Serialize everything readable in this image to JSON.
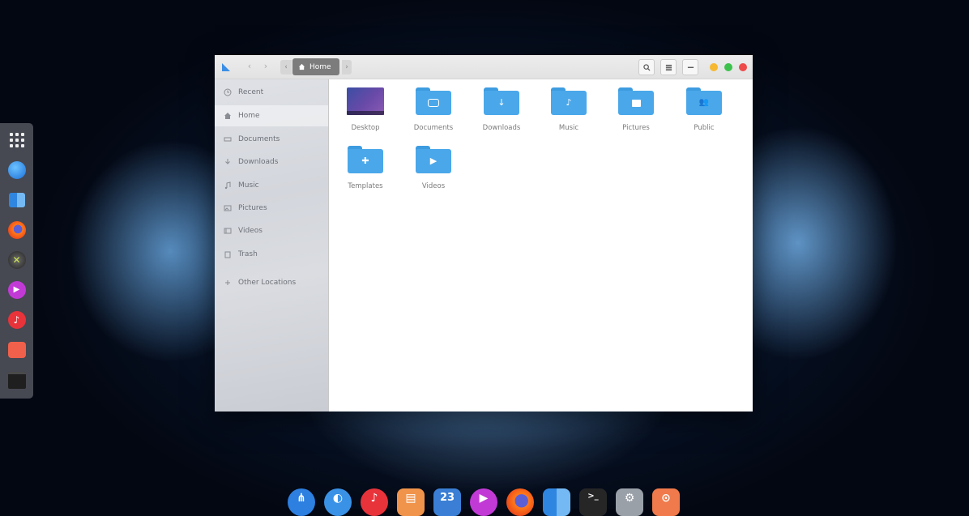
{
  "window": {
    "breadcrumb": {
      "current": "Home"
    }
  },
  "sidebar": {
    "items": [
      {
        "label": "Recent",
        "icon": "clock-icon"
      },
      {
        "label": "Home",
        "icon": "home-icon",
        "active": true
      },
      {
        "label": "Documents",
        "icon": "document-icon"
      },
      {
        "label": "Downloads",
        "icon": "download-icon"
      },
      {
        "label": "Music",
        "icon": "music-icon"
      },
      {
        "label": "Pictures",
        "icon": "picture-icon"
      },
      {
        "label": "Videos",
        "icon": "video-icon"
      },
      {
        "label": "Trash",
        "icon": "trash-icon"
      },
      {
        "label": "Other Locations",
        "icon": "plus-icon"
      }
    ]
  },
  "folders": [
    {
      "label": "Desktop",
      "icon": "desktop-thumbnail"
    },
    {
      "label": "Documents",
      "icon": "documents-folder-icon"
    },
    {
      "label": "Downloads",
      "icon": "downloads-folder-icon"
    },
    {
      "label": "Music",
      "icon": "music-folder-icon"
    },
    {
      "label": "Pictures",
      "icon": "pictures-folder-icon"
    },
    {
      "label": "Public",
      "icon": "public-folder-icon"
    },
    {
      "label": "Templates",
      "icon": "templates-folder-icon"
    },
    {
      "label": "Videos",
      "icon": "videos-folder-icon"
    }
  ],
  "bottom_dock": {
    "calendar_day": "23"
  },
  "colors": {
    "folder": "#4aa8ea",
    "close": "#ee4a4a",
    "maximize": "#3cc24c",
    "minimize": "#f5b830"
  }
}
